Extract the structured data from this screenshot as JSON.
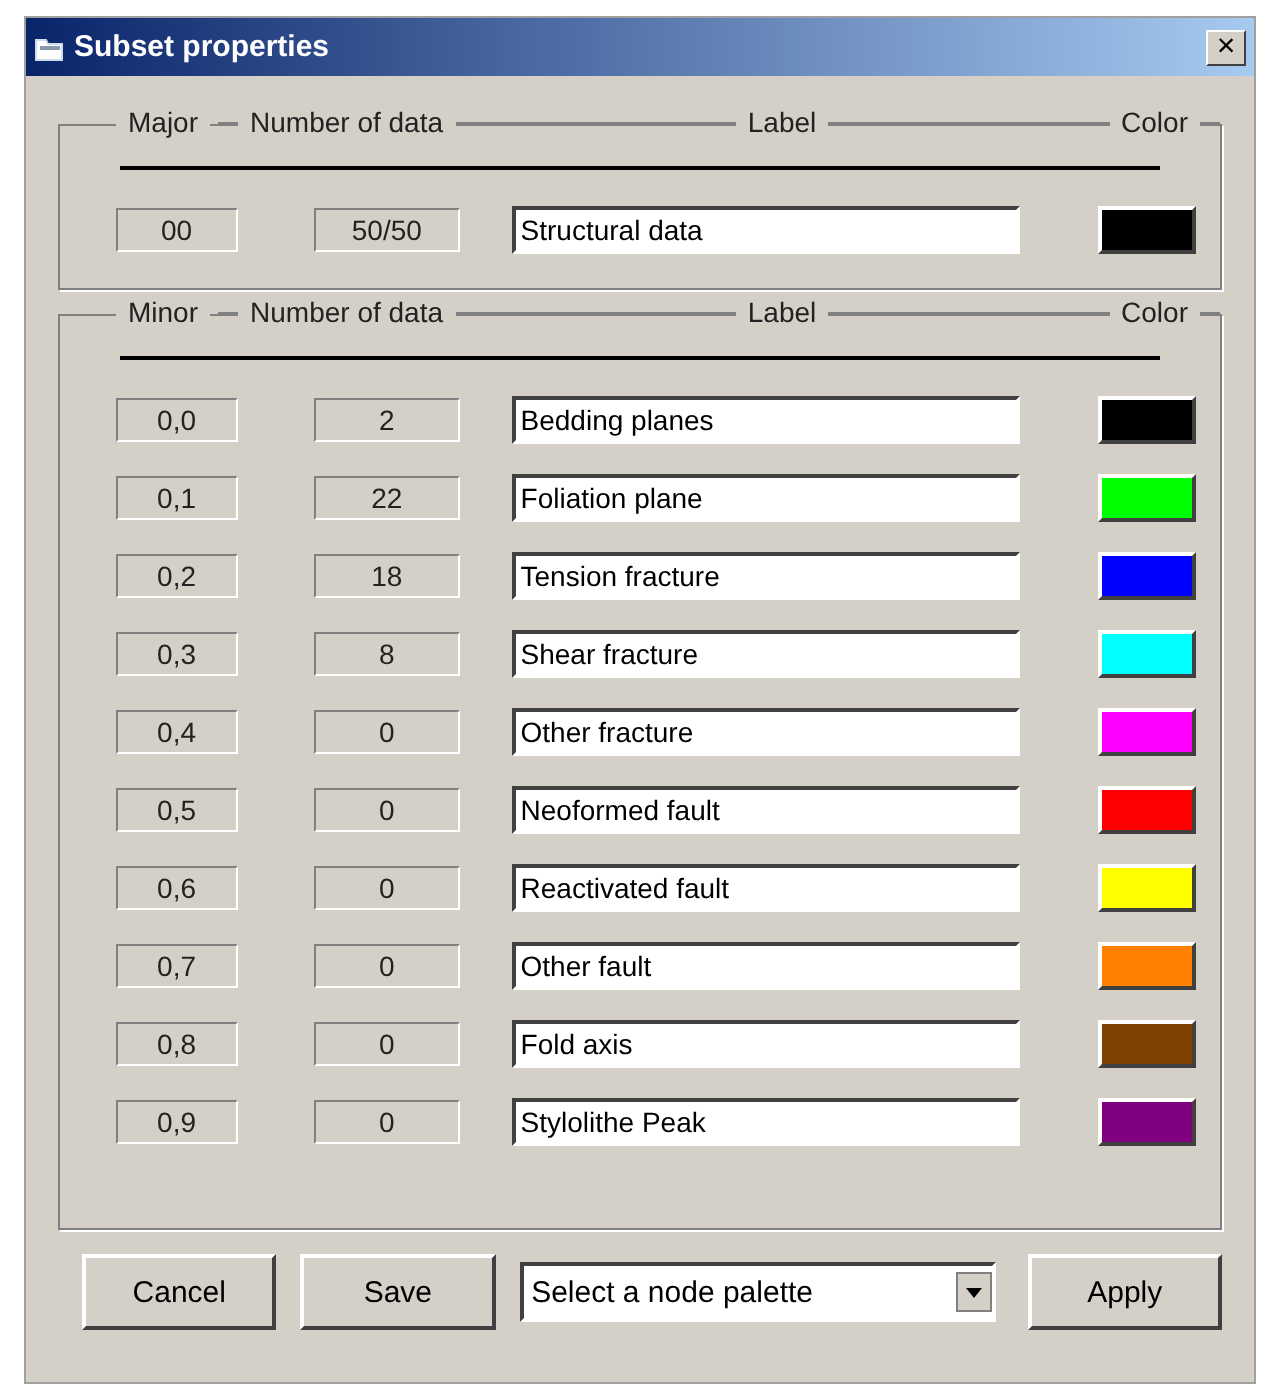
{
  "window": {
    "title": "Subset properties",
    "close": "×"
  },
  "major_group": {
    "headers": [
      "Major",
      "Number of data",
      "Label",
      "Color"
    ],
    "rows": [
      {
        "id": "00",
        "count": "50/50",
        "label": "Structural data",
        "color": "#000000"
      }
    ]
  },
  "minor_group": {
    "headers": [
      "Minor",
      "Number of data",
      "Label",
      "Color"
    ],
    "rows": [
      {
        "id": "0,0",
        "count": "2",
        "label": "Bedding planes",
        "color": "#000000"
      },
      {
        "id": "0,1",
        "count": "22",
        "label": "Foliation plane",
        "color": "#00ff00"
      },
      {
        "id": "0,2",
        "count": "18",
        "label": "Tension fracture",
        "color": "#0000ff"
      },
      {
        "id": "0,3",
        "count": "8",
        "label": "Shear fracture",
        "color": "#00ffff"
      },
      {
        "id": "0,4",
        "count": "0",
        "label": "Other fracture",
        "color": "#ff00ff"
      },
      {
        "id": "0,5",
        "count": "0",
        "label": "Neoformed fault",
        "color": "#ff0000"
      },
      {
        "id": "0,6",
        "count": "0",
        "label": "Reactivated fault",
        "color": "#ffff00"
      },
      {
        "id": "0,7",
        "count": "0",
        "label": "Other fault",
        "color": "#ff8000"
      },
      {
        "id": "0,8",
        "count": "0",
        "label": "Fold axis",
        "color": "#804000"
      },
      {
        "id": "0,9",
        "count": "0",
        "label": "Stylolithe Peak",
        "color": "#800080"
      }
    ]
  },
  "buttons": {
    "cancel": "Cancel",
    "save": "Save",
    "palette": {
      "value": "Select a node palette"
    },
    "apply": "Apply"
  }
}
